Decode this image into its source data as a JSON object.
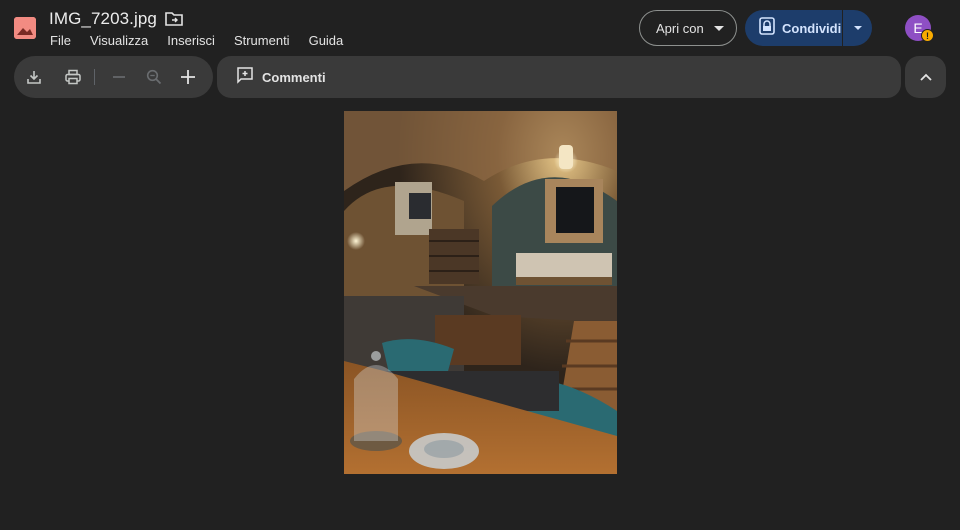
{
  "header": {
    "title": "IMG_7203.jpg",
    "file_icon": "image-file-icon",
    "move_icon": "move-to-folder-icon"
  },
  "menu": [
    "File",
    "Visualizza",
    "Inserisci",
    "Strumenti",
    "Guida"
  ],
  "actions": {
    "open_with": "Apri con",
    "share": "Condividi",
    "avatar_initial": "E",
    "avatar_badge": "!"
  },
  "toolbar": {
    "icons": [
      "download-icon",
      "print-icon",
      "zoom-out-icon",
      "zoom-icon",
      "zoom-in-icon"
    ],
    "comments_label": "Commenti",
    "collapse_icon": "chevron-up-icon"
  },
  "colors": {
    "background": "#212121",
    "toolbar": "#3a3a3a",
    "share_button": "#1d3d6b",
    "share_text": "#d3e3fd",
    "avatar": "#8e4fc4",
    "file_icon": "#f28b82"
  }
}
